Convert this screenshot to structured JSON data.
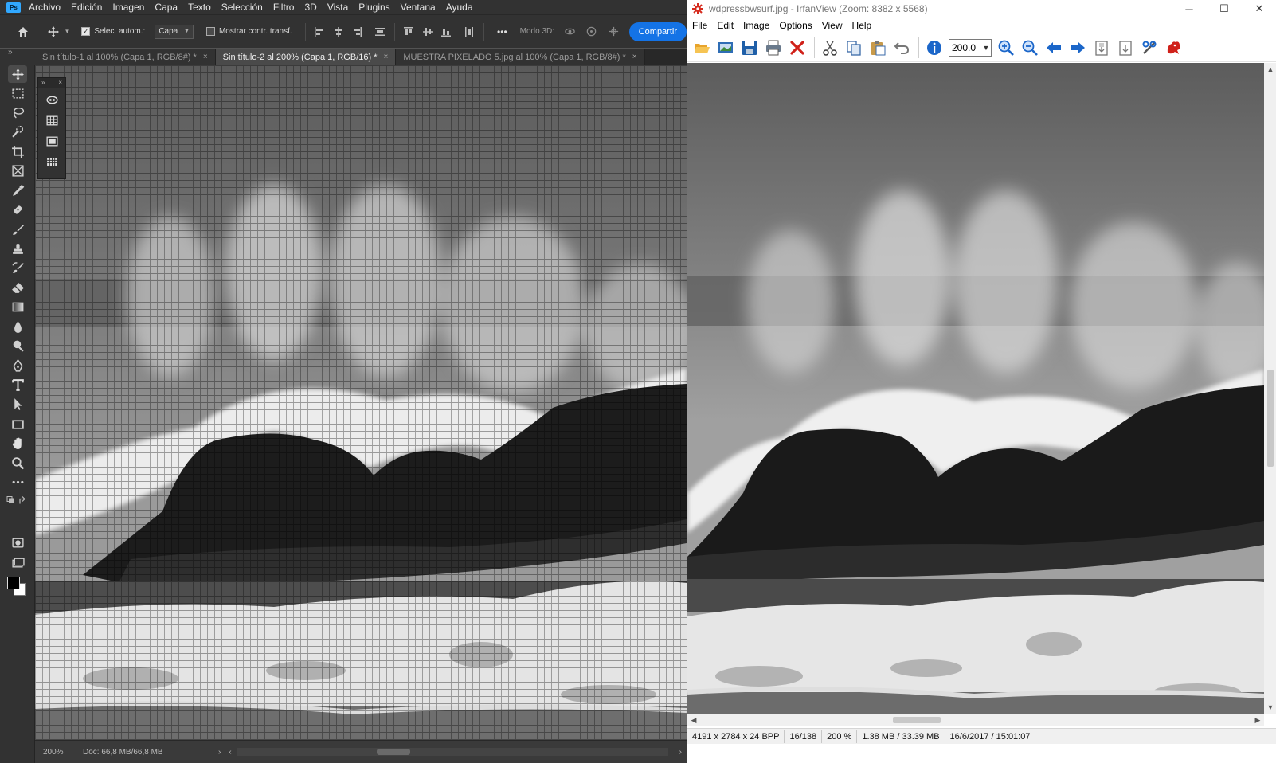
{
  "photoshop": {
    "logo": "Ps",
    "menu": [
      "Archivo",
      "Edición",
      "Imagen",
      "Capa",
      "Texto",
      "Selección",
      "Filtro",
      "3D",
      "Vista",
      "Plugins",
      "Ventana",
      "Ayuda"
    ],
    "options": {
      "auto_select_label": "Selec. autom.:",
      "auto_select_checked": true,
      "layer_select_value": "Capa",
      "show_transform_label": "Mostrar contr. transf.",
      "show_transform_checked": false,
      "more_label": "•••",
      "mode3d_label": "Modo 3D:",
      "share_label": "Compartir"
    },
    "tabs": [
      {
        "label": "Sin título-1 al 100% (Capa 1, RGB/8#) *",
        "active": false
      },
      {
        "label": "Sin título-2 al 200% (Capa 1, RGB/16) *",
        "active": true
      },
      {
        "label": "MUESTRA PIXELADO 5.jpg al 100% (Capa 1, RGB/8#) *",
        "active": false
      }
    ],
    "tab_close": "×",
    "status": {
      "zoom": "200%",
      "doc": "Doc: 66,8 MB/66,8 MB"
    },
    "tools": [
      "move-tool-icon",
      "marquee-tool-icon",
      "lasso-tool-icon",
      "quick-selection-tool-icon",
      "crop-tool-icon",
      "frame-tool-icon",
      "eyedropper-tool-icon",
      "healing-brush-tool-icon",
      "brush-tool-icon",
      "clone-stamp-tool-icon",
      "history-brush-tool-icon",
      "eraser-tool-icon",
      "gradient-tool-icon",
      "blur-tool-icon",
      "dodge-tool-icon",
      "pen-tool-icon",
      "type-tool-icon",
      "path-selection-tool-icon",
      "rectangle-tool-icon",
      "hand-tool-icon",
      "zoom-tool-icon",
      "more-tools-icon"
    ],
    "colors": {
      "foreground": "#000000",
      "background": "#ffffff",
      "accent": "#1473e6"
    }
  },
  "irfanview": {
    "title": "wdpressbwsurf.jpg - IrfanView (Zoom: 8382 x 5568)",
    "menu": [
      "File",
      "Edit",
      "Image",
      "Options",
      "View",
      "Help"
    ],
    "zoom_value": "200.0",
    "window_controls": {
      "minimize": "─",
      "maximize": "☐",
      "close": "✕"
    },
    "status": {
      "dimensions": "4191 x 2784 x 24 BPP",
      "index": "16/138",
      "zoom": "200 %",
      "size": "1.38 MB / 33.39 MB",
      "datetime": "16/6/2017 / 15:01:07"
    }
  }
}
